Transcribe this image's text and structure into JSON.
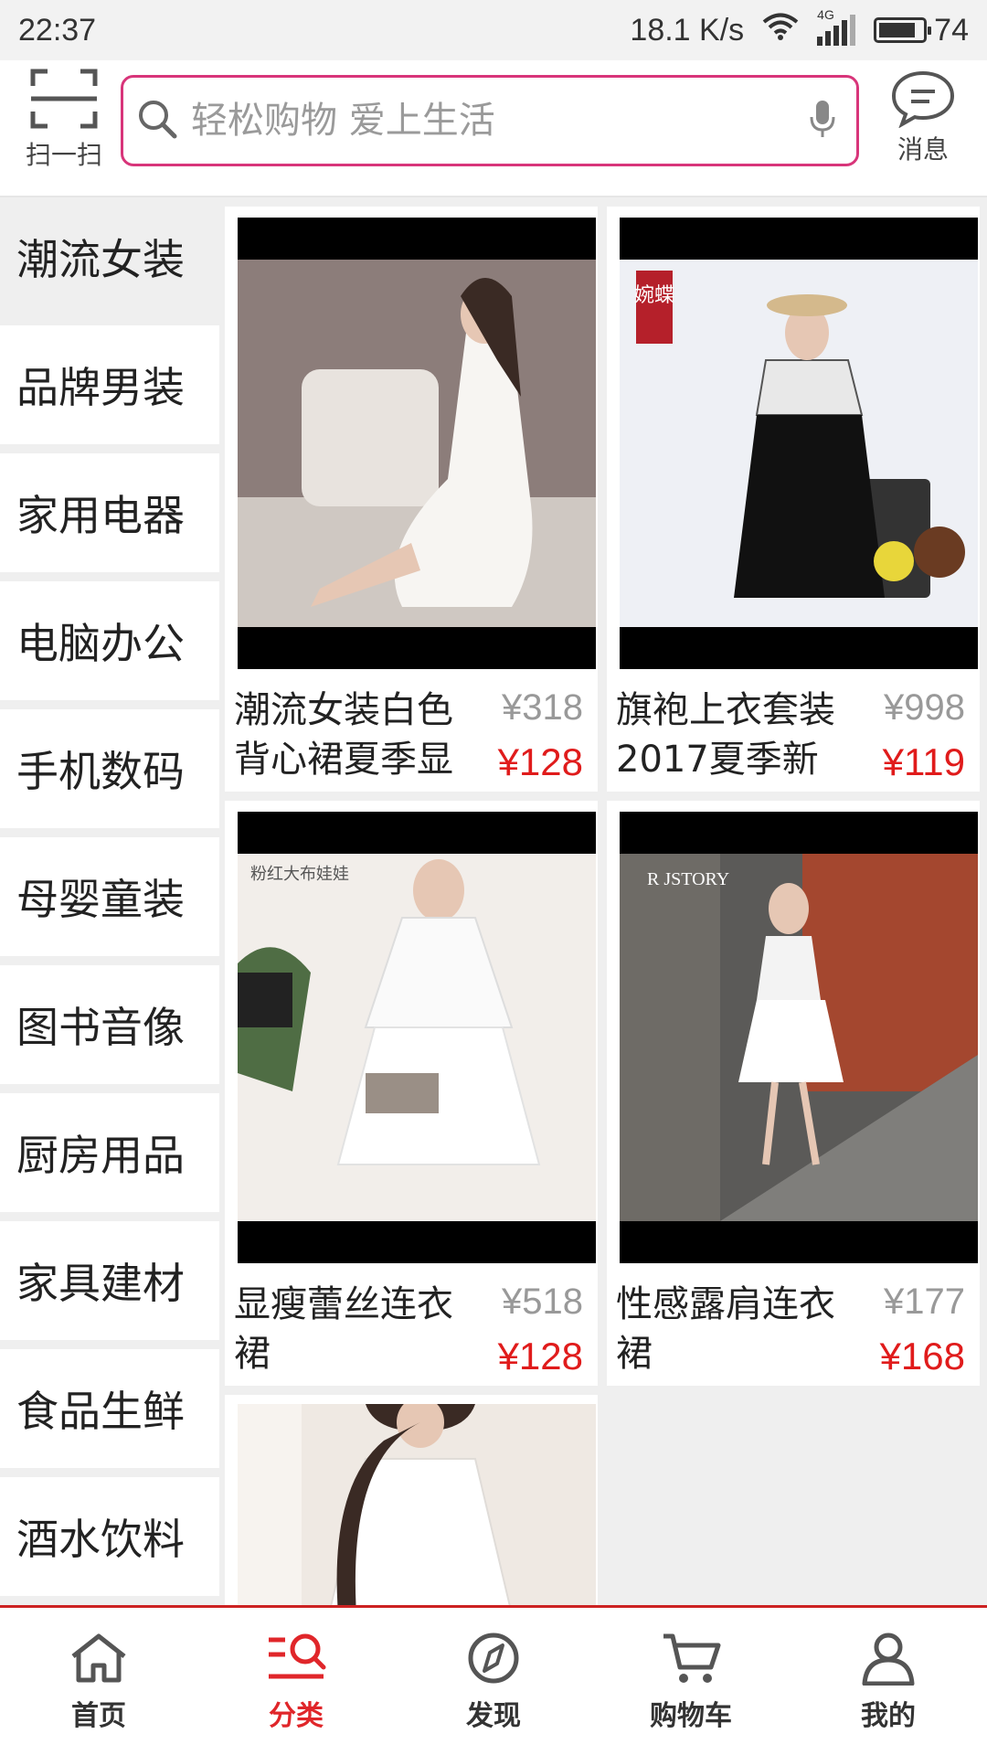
{
  "status": {
    "time": "22:37",
    "network_speed": "18.1 K/s",
    "network_type": "4G",
    "battery": "74"
  },
  "header": {
    "scan_label": "扫一扫",
    "search_placeholder": "轻松购物 爱上生活",
    "message_label": "消息"
  },
  "categories": [
    {
      "label": "潮流女装",
      "active": true
    },
    {
      "label": "品牌男装"
    },
    {
      "label": "家用电器"
    },
    {
      "label": "电脑办公"
    },
    {
      "label": "手机数码"
    },
    {
      "label": "母婴童装"
    },
    {
      "label": "图书音像"
    },
    {
      "label": "厨房用品"
    },
    {
      "label": "家具建材"
    },
    {
      "label": "食品生鲜"
    },
    {
      "label": "酒水饮料"
    }
  ],
  "products": [
    {
      "title": "潮流女装白色背心裙夏季显",
      "old_price": "¥318",
      "price": "¥128"
    },
    {
      "title": "旗袍上衣套装2017夏季新",
      "old_price": "¥998",
      "price": "¥119",
      "image_text": "婉蝶"
    },
    {
      "title": "显瘦蕾丝连衣裙",
      "old_price": "¥518",
      "price": "¥128",
      "image_text": "粉红大布娃娃"
    },
    {
      "title": "性感露肩连衣裙",
      "old_price": "¥177",
      "price": "¥168",
      "image_text": "R JSTORY"
    },
    {
      "title": "",
      "old_price": "",
      "price": ""
    }
  ],
  "bottom_nav": [
    {
      "label": "首页",
      "icon": "home-icon"
    },
    {
      "label": "分类",
      "icon": "category-icon",
      "active": true
    },
    {
      "label": "发现",
      "icon": "compass-icon"
    },
    {
      "label": "购物车",
      "icon": "cart-icon"
    },
    {
      "label": "我的",
      "icon": "user-icon"
    }
  ],
  "colors": {
    "accent": "#e0262a",
    "search_border": "#d8357a",
    "sidebar_bg": "#efefef"
  }
}
